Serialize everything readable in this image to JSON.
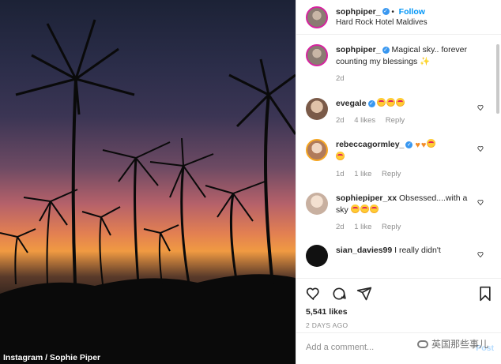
{
  "photo": {
    "credit": "Instagram / Sophie Piper"
  },
  "header": {
    "username": "sophpiper_",
    "verified_glyph": "✓",
    "follow": "Follow",
    "separator": "•",
    "location": "Hard Rock Hotel Maldives"
  },
  "caption": {
    "username": "sophpiper_",
    "text": "Magical sky.. forever counting my blessings",
    "emoji": "✨",
    "time": "2d"
  },
  "comments": [
    {
      "username": "evegale",
      "verified": true,
      "emoji_count": 3,
      "text": "",
      "time": "2d",
      "likes": "4 likes",
      "reply": "Reply"
    },
    {
      "username": "rebeccagormley_",
      "verified": true,
      "emoji_seq": [
        "heart",
        "heart",
        "face",
        "face"
      ],
      "text": "",
      "time": "1d",
      "likes": "1 like",
      "reply": "Reply"
    },
    {
      "username": "sophiepiper_xx",
      "verified": false,
      "text": "Obsessed....with a sky",
      "emoji_count": 3,
      "time": "2d",
      "likes": "1 like",
      "reply": "Reply"
    },
    {
      "username": "sian_davies99",
      "verified": false,
      "text": "I really didn't"
    }
  ],
  "actions": {
    "likes": "5,541 likes",
    "date": "2 DAYS AGO"
  },
  "add_comment": {
    "placeholder": "Add a comment...",
    "post": "Post"
  },
  "watermark": {
    "text": "英国那些事儿"
  },
  "icons": {
    "like": "heart-icon",
    "comment": "comment-icon",
    "share": "share-icon",
    "save": "bookmark-icon"
  },
  "colors": {
    "accent": "#0095f6",
    "verified": "#3897f0"
  }
}
